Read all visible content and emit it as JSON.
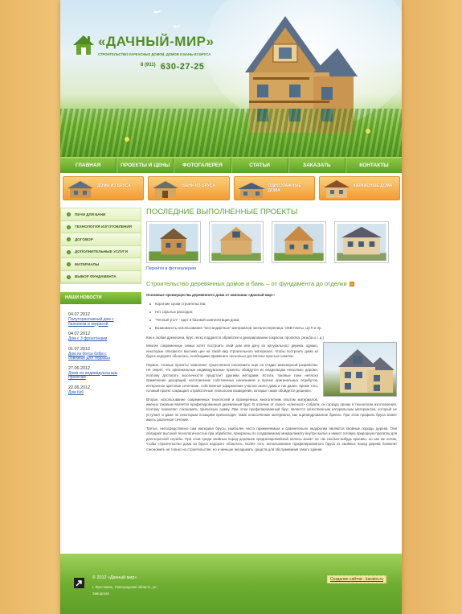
{
  "header": {
    "logo_title": "«ДАЧНЫЙ-МИР»",
    "logo_subtitle": "СТРОИТЕЛЬСТВО КАРКАСНЫХ ДОМОВ, ДОМОВ И БАНЬ ИЗ БРУСА",
    "phone_code": "8 (911)",
    "phone_number": "630-27-25"
  },
  "nav": {
    "items": [
      {
        "label": "ГЛАВНАЯ"
      },
      {
        "label": "ПРОЕКТЫ И ЦЕНЫ"
      },
      {
        "label": "ФОТОГАЛЕРЕЯ"
      },
      {
        "label": "СТАТЬИ"
      },
      {
        "label": "ЗАКАЗАТЬ"
      },
      {
        "label": "КОНТАКТЫ"
      }
    ]
  },
  "categories": [
    {
      "label": "ДОМА ИЗ БРУСА"
    },
    {
      "label": "БАНИ ИЗ БРУСА"
    },
    {
      "label": "ОДНОЭТАЖНЫЕ ДОМА"
    },
    {
      "label": "КАРКАСНЫЕ ДОМА"
    }
  ],
  "sidebar": {
    "items": [
      {
        "label": "ПЕЧИ ДЛЯ БАНИ"
      },
      {
        "label": "ТЕХНОЛОГИЯ ИЗГОТОВЛЕНИЯ"
      },
      {
        "label": "ДОГОВОР"
      },
      {
        "label": "ДОПОЛНИТЕЛЬНЫЕ УСЛУГИ"
      },
      {
        "label": "МАТЕРИАЛЫ"
      },
      {
        "label": "ВЫБОР ФУНДАМЕНТА"
      }
    ],
    "news_heading": "НАШИ НОВОСТИ",
    "news": [
      {
        "date": "04.07.2012",
        "title": "Полутораэтажный дом с балконом и террасой"
      },
      {
        "date": "04.07.2012",
        "title": "Дом с 3 фронтонами"
      },
      {
        "date": "01.07.2012",
        "title": "Дом из бруса 6х6м с обвязкой для террасы"
      },
      {
        "date": "27.06.2012",
        "title": "Дома по индивидуальным проектам"
      },
      {
        "date": "22.06.2012",
        "title": "Дом 6х6"
      }
    ]
  },
  "main": {
    "projects_title": "ПОСЛЕДНИЕ ВЫПОЛНЕННЫЕ ПРОЕКТЫ",
    "gallery_link": "Перейти в фотогалерею",
    "article_title": "Строительство деревянных домов и бань – от фундамента до отделки",
    "lead": "Основные преимущества деревянного дома от компании «Дачный мир»:",
    "bullets": [
      "Короткие сроки строительства;",
      "Нет скрытых расходов;",
      "\"Теплый угол\" - идет в базовой комплектации дома;",
      "Возможность использования \"нестандартных\" материалов: металлочерепица, OSB-плиты, ЦСП и пр."
    ],
    "paragraphs": [
      "Как и любая древесина, брус легко поддается обработке и декорированию (окраска, пропитка, резьба и т. д.)",
      "Многие современные семьи хотят построить свой дом или дачу из натурального дерева, однако, некоторые опасаются высоких цен на такой вид строительного материала. Чтобы построить дома из бруса недорого обошлось, необходимо применить несколько достаточно простых советов.",
      "Первое, готовые проекты позволяют существенно сэкономить еще на стадии инженерной разработки. Не секрет, что оригинальные индивидуальные проекты обойдутся их владельцам несколько дороже, поэтому достигать экзотичности предстоит другими методами. Кстати, таковые тоже неплохо применение декораций, изготовление собственных наличников и прочих оригинальных атрибутов, интересное цветовое сочетание, собственное оформление участка около дома и так далее. Кроме того, готовый проект сокращает отработочные технологии возведения, которые также обойдется дешевле.",
      "Второе, использование современных технологий и проверенных многолетним опытом материалов, именно таковым является профилированный деревянный брус. В отличие от своего «клееного» собрата, он гораздо проще в технологии изготовления, поэтому позволяет сэкономить приличную сумму. При этом профилированный брус является качественным натуральным материалом, который не уступает и даже по некоторым позициям превосходит такие классические материалы, как оцилиндрованное бревно. При этом профиль бруса может иметь различное сечение.",
      "Третье, непосредственно сам материал брусы, наиболее часто применяемым и сравнительно недорогим являются хвойные породы дерева. Они обладают высокой технологичностью при обработке, прекрасны по создаваемому микроклимату внутри жилья и имеют готовую природную пропитку для долгосрочной службы. При этом среди хвойных пород деревьев среднеевропейской полосы может не так сколько-нибудь красиво, но как же хотим, чтобы строительство дома из бруса недорого обошлось. Более того, использование профилированного бруса из хвойных пород дерева позволит сэкономить не только на строительстве, но и меньше вкладывать средств для обслуживания такого здания."
    ]
  },
  "footer": {
    "copyright": "© 2012 «Дачный мир»",
    "address": "г. Ярославль, Новгородская область, ул. Заводская",
    "developer_link": "Создание сайтов - karatov.ru"
  },
  "colors": {
    "accent_green": "#5e9f25",
    "accent_orange": "#f29a33",
    "link_blue": "#2a5aa8",
    "wood_background": "#efc377"
  }
}
